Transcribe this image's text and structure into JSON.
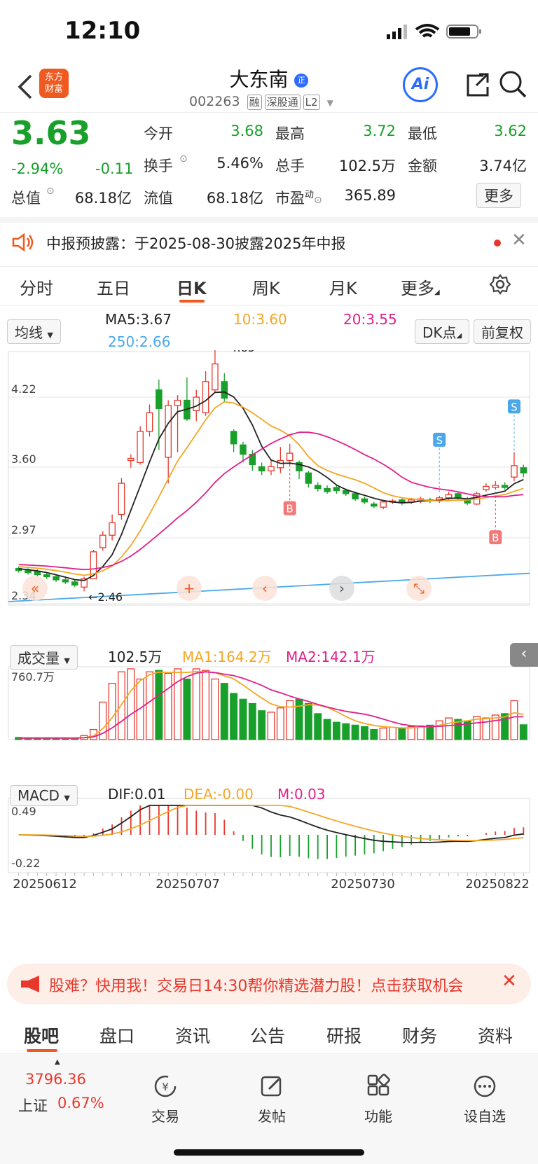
{
  "status_bar": {
    "time": "12:10"
  },
  "header": {
    "stock_name": "大东南",
    "stock_code": "002263",
    "tags": [
      "融",
      "深股通",
      "L2"
    ]
  },
  "quote": {
    "price": "3.63",
    "change_pct": "-2.94%",
    "change": "-0.11",
    "rows": [
      [
        {
          "label": "今开",
          "value": "3.68",
          "color": "green"
        },
        {
          "label": "最高",
          "value": "3.72",
          "color": "green"
        },
        {
          "label": "最低",
          "value": "3.62",
          "color": "green"
        }
      ],
      [
        {
          "label": "换手",
          "value": "5.46%",
          "color": "dark"
        },
        {
          "label": "总手",
          "value": "102.5万",
          "color": "dark"
        },
        {
          "label": "金额",
          "value": "3.74亿",
          "color": "dark"
        }
      ],
      [
        {
          "label": "流值",
          "value": "68.18亿",
          "color": "dark"
        },
        {
          "label": "市盈",
          "value": "365.89",
          "color": "dark"
        }
      ]
    ],
    "total_value_label": "总值",
    "total_value": "68.18亿",
    "pe_superscript": "动",
    "more_button": "更多"
  },
  "notice": {
    "text": "中报预披露：于2025-08-30披露2025年中报"
  },
  "tabs": {
    "items": [
      "分时",
      "五日",
      "日K",
      "周K",
      "月K",
      "更多"
    ],
    "active": "日K"
  },
  "indicators": {
    "ma_select": "均线",
    "ma5": "MA5:3.67",
    "ma10": "10:3.60",
    "ma20": "20:3.55",
    "ma250": "250:2.66",
    "dk_button": "DK点",
    "fq_button": "前复权",
    "vol_select": "成交量",
    "vol_value": "102.5万",
    "vol_ma1": "MA1:164.2万",
    "vol_ma2": "MA2:142.1万",
    "macd_select": "MACD",
    "dif": "DIF:0.01",
    "dea": "DEA:-0.00",
    "m": "M:0.03"
  },
  "colors": {
    "up": "#e8382c",
    "down": "#18a02a",
    "ma5": "#222222",
    "ma10": "#f5a623",
    "ma20": "#e0208c",
    "ma250": "#4aa8ea"
  },
  "chart_data": {
    "type": "candlestick",
    "price_axis": [
      "4.85",
      "4.22",
      "3.60",
      "2.97",
      "2.34"
    ],
    "high_label": "4.85",
    "low_label": "2.46",
    "vol_axis_max": "760.7万",
    "macd_axis": [
      "0.49",
      "-0.22"
    ],
    "dates": [
      "20250612",
      "20250707",
      "20250730",
      "20250822"
    ],
    "signals": [
      "S",
      "S",
      "B",
      "B"
    ],
    "candles": [
      [
        2.68,
        2.66,
        2.7,
        2.64
      ],
      [
        2.66,
        2.64,
        2.68,
        2.62
      ],
      [
        2.65,
        2.62,
        2.67,
        2.6
      ],
      [
        2.62,
        2.6,
        2.64,
        2.58
      ],
      [
        2.6,
        2.57,
        2.62,
        2.55
      ],
      [
        2.57,
        2.55,
        2.59,
        2.53
      ],
      [
        2.55,
        2.52,
        2.57,
        2.5
      ],
      [
        2.5,
        2.58,
        2.6,
        2.46
      ],
      [
        2.58,
        2.84,
        2.86,
        2.58
      ],
      [
        2.88,
        3.0,
        3.04,
        2.85
      ],
      [
        3.0,
        3.12,
        3.2,
        2.95
      ],
      [
        3.2,
        3.5,
        3.55,
        3.15
      ],
      [
        3.72,
        3.74,
        3.78,
        3.65
      ],
      [
        3.7,
        4.0,
        4.05,
        3.68
      ],
      [
        4.0,
        4.18,
        4.26,
        3.95
      ],
      [
        4.4,
        4.22,
        4.5,
        3.82
      ],
      [
        3.75,
        4.25,
        4.3,
        3.5
      ],
      [
        4.25,
        4.3,
        4.35,
        3.8
      ],
      [
        4.3,
        4.12,
        4.52,
        4.1
      ],
      [
        4.2,
        4.33,
        4.4,
        4.1
      ],
      [
        4.18,
        4.48,
        4.58,
        4.15
      ],
      [
        4.4,
        4.65,
        4.85,
        4.38
      ],
      [
        4.48,
        4.32,
        4.56,
        4.28
      ],
      [
        4.0,
        3.88,
        4.02,
        3.8
      ],
      [
        3.87,
        3.78,
        3.9,
        3.7
      ],
      [
        3.78,
        3.68,
        3.82,
        3.62
      ],
      [
        3.66,
        3.62,
        3.7,
        3.58
      ],
      [
        3.62,
        3.66,
        3.72,
        3.58
      ],
      [
        3.65,
        3.72,
        3.85,
        3.6
      ],
      [
        3.72,
        3.79,
        3.88,
        3.68
      ],
      [
        3.7,
        3.62,
        3.72,
        3.54
      ],
      [
        3.6,
        3.5,
        3.62,
        3.46
      ],
      [
        3.48,
        3.45,
        3.51,
        3.42
      ],
      [
        3.45,
        3.42,
        3.48,
        3.4
      ],
      [
        3.46,
        3.43,
        3.48,
        3.4
      ],
      [
        3.43,
        3.4,
        3.45,
        3.38
      ],
      [
        3.4,
        3.35,
        3.42,
        3.33
      ],
      [
        3.35,
        3.32,
        3.37,
        3.3
      ],
      [
        3.3,
        3.28,
        3.32,
        3.26
      ],
      [
        3.27,
        3.32,
        3.34,
        3.25
      ],
      [
        3.32,
        3.33,
        3.35,
        3.3
      ],
      [
        3.34,
        3.31,
        3.36,
        3.29
      ],
      [
        3.32,
        3.34,
        3.36,
        3.3
      ],
      [
        3.33,
        3.35,
        3.37,
        3.31
      ],
      [
        3.34,
        3.33,
        3.36,
        3.31
      ],
      [
        3.33,
        3.36,
        3.38,
        3.31
      ],
      [
        3.36,
        3.39,
        3.42,
        3.34
      ],
      [
        3.4,
        3.36,
        3.42,
        3.34
      ],
      [
        3.35,
        3.31,
        3.37,
        3.29
      ],
      [
        3.3,
        3.4,
        3.42,
        3.29
      ],
      [
        3.44,
        3.47,
        3.5,
        3.42
      ],
      [
        3.46,
        3.48,
        3.52,
        3.44
      ],
      [
        3.48,
        3.46,
        3.51,
        3.44
      ],
      [
        3.56,
        3.67,
        3.8,
        3.52
      ],
      [
        3.65,
        3.6,
        3.68,
        3.56
      ]
    ],
    "volume_wan": [
      15,
      12,
      12,
      10,
      10,
      9,
      9,
      28,
      70,
      260,
      390,
      470,
      500,
      420,
      470,
      480,
      460,
      500,
      420,
      500,
      480,
      420,
      390,
      320,
      280,
      250,
      200,
      190,
      220,
      270,
      280,
      250,
      180,
      140,
      120,
      110,
      100,
      90,
      70,
      80,
      85,
      80,
      90,
      95,
      100,
      130,
      150,
      140,
      130,
      160,
      150,
      170,
      180,
      270,
      102.5
    ]
  },
  "promo": {
    "text": "股难？快用我！交易日14:30帮你精选潜力股！点击获取机会"
  },
  "bottom_tabs": [
    "股吧",
    "盘口",
    "资讯",
    "公告",
    "研报",
    "财务",
    "资料"
  ],
  "bottom_bar": {
    "index_value": "3796.36",
    "index_name": "上证",
    "index_change": "0.67%",
    "items": [
      "交易",
      "发帖",
      "功能",
      "设自选"
    ]
  }
}
